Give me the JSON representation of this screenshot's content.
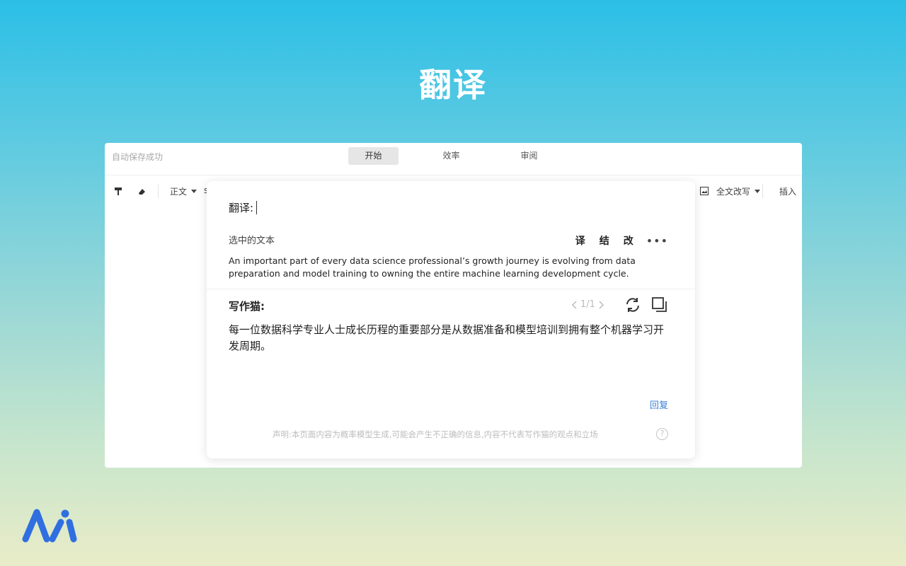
{
  "hero": {
    "title": "翻译"
  },
  "app": {
    "autosave_status": "自动保存成功",
    "tabs": [
      {
        "label": "开始",
        "active": true
      },
      {
        "label": "效率",
        "active": false
      },
      {
        "label": "审阅",
        "active": false
      }
    ],
    "toolbar": {
      "paragraph_style": "正文",
      "truncated_text": "s",
      "rewrite": "全文改写",
      "insert": "插入"
    }
  },
  "popup": {
    "input_label": "翻译:",
    "selected_label": "选中的文本",
    "actions": [
      {
        "label": "译"
      },
      {
        "label": "结"
      },
      {
        "label": "改"
      }
    ],
    "selected_text": "An important part of every data science professional’s growth journey is evolving from data preparation and model training to owning the entire machine learning development cycle.",
    "answer_label": "写作猫:",
    "pager": {
      "text": "1/1"
    },
    "answer_text": "每一位数据科学专业人士成长历程的重要部分是从数据准备和模型培训到拥有整个机器学习开发周期。",
    "reply_label": "回复",
    "disclaimer": "声明:本页面内容为概率模型生成,可能会产生不正确的信息,内容不代表写作猫的观点和立场",
    "help_glyph": "?"
  },
  "colors": {
    "accent_link": "#3b82d8",
    "logo_blue": "#2f6fe0"
  }
}
